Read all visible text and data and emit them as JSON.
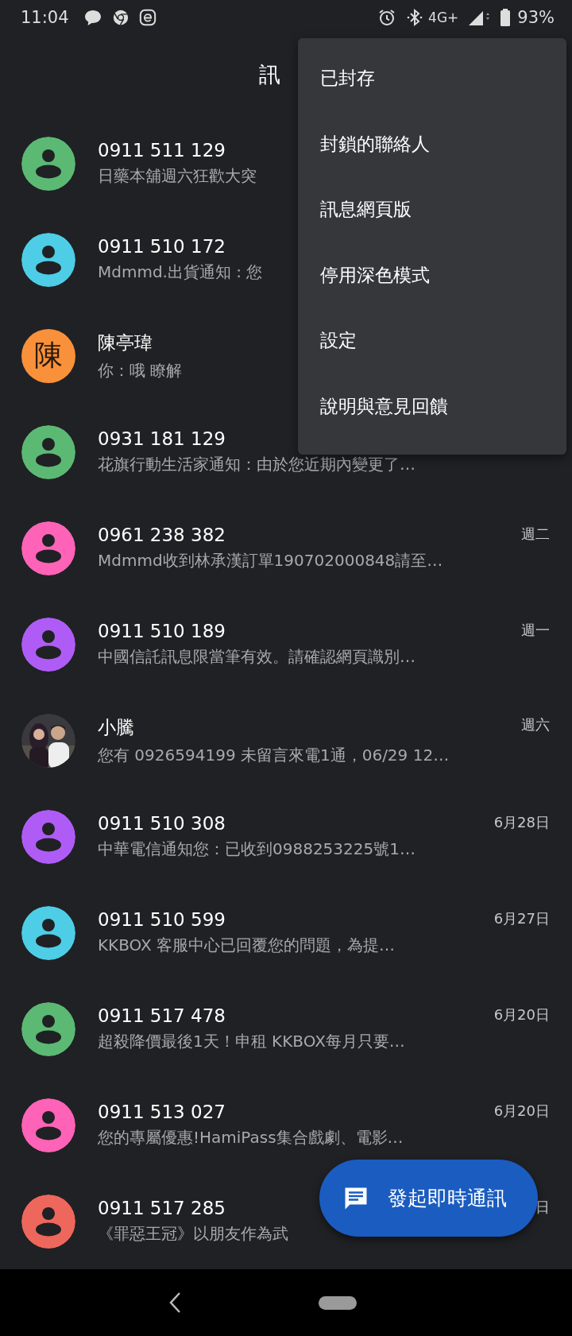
{
  "status_bar": {
    "time": "11:04",
    "network": "4G+",
    "battery": "93%"
  },
  "header": {
    "title": "訊"
  },
  "conversations": [
    {
      "name": "0911 511 129",
      "snippet": "日藥本舖週六狂歡大突",
      "avatar": {
        "kind": "person",
        "color": "#5bb974"
      }
    },
    {
      "name": "0911 510 172",
      "snippet": "Mdmmd.出貨通知 : 您",
      "avatar": {
        "kind": "person",
        "color": "#4ecde6"
      }
    },
    {
      "name": "陳亭瑋",
      "snippet": "你：哦 瞭解",
      "avatar": {
        "kind": "letter",
        "letter": "陳",
        "color": "#f9913a"
      }
    },
    {
      "name": "0931 181 129",
      "snippet": "花旗行動生活家通知：由於您近期內變更了…",
      "avatar": {
        "kind": "person",
        "color": "#5bb974"
      }
    },
    {
      "name": "0961 238 382",
      "snippet": "Mdmmd收到林承漢訂單190702000848請至…",
      "time": "週二",
      "avatar": {
        "kind": "person",
        "color": "#ff63b8"
      }
    },
    {
      "name": "0911 510 189",
      "snippet": "中國信託訊息限當筆有效。請確認網頁識別…",
      "time": "週一",
      "avatar": {
        "kind": "person",
        "color": "#af5cf7"
      }
    },
    {
      "name": "小騰",
      "snippet": "您有 0926594199 未留言來電1通，06/29 12…",
      "time": "週六"
    },
    {
      "name": "0911 510 308",
      "snippet": "中華電信通知您：已收到0988253225號1…",
      "time": "6月28日",
      "avatar": {
        "kind": "person",
        "color": "#af5cf7"
      }
    },
    {
      "name": "0911 510 599",
      "snippet": "KKBOX 客服中心已回覆您的問題，為提…",
      "time": "6月27日",
      "avatar": {
        "kind": "person",
        "color": "#4ecde6"
      }
    },
    {
      "name": "0911 517 478",
      "snippet": "超殺降價最後1天！申租 KKBOX每月只要…",
      "time": "6月20日",
      "avatar": {
        "kind": "person",
        "color": "#5bb974"
      }
    },
    {
      "name": "0911 513 027",
      "snippet": "您的專屬優惠!HamiPass集合戲劇、電影…",
      "time": "6月20日",
      "avatar": {
        "kind": "person",
        "color": "#ff63b8"
      }
    },
    {
      "name": "0911 517 285",
      "snippet": "《罪惡王冠》以朋友作為武",
      "time": "日",
      "avatar": {
        "kind": "person",
        "color": "#ee675c"
      }
    }
  ],
  "menu": {
    "items": [
      "已封存",
      "封鎖的聯絡人",
      "訊息網頁版",
      "停用深色模式",
      "設定",
      "說明與意見回饋"
    ]
  },
  "fab": {
    "label": "發起即時通訊"
  }
}
